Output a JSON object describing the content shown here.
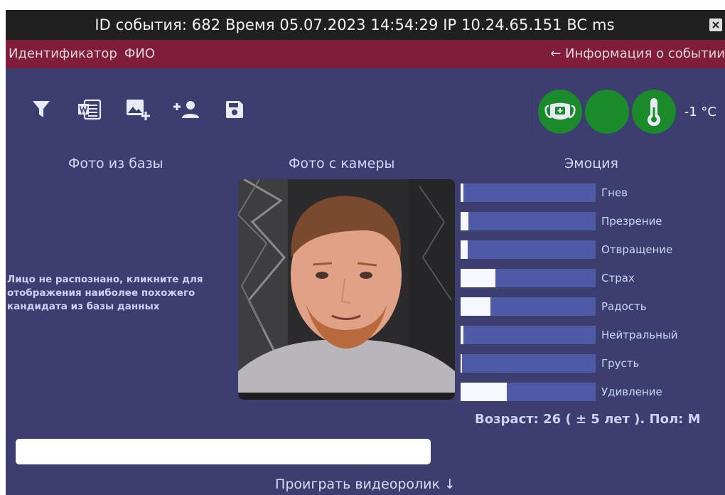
{
  "titlebar": {
    "title": "ID события: 682  Время 05.07.2023 14:54:29 IP 10.24.65.151 BC  ms"
  },
  "subbar": {
    "tab_identifier": "Идентификатор",
    "tab_fio": "ФИО",
    "info_link": "← Информация о событии"
  },
  "toolbar": {
    "icons": [
      "filter-icon",
      "word-document-icon",
      "add-image-icon",
      "add-person-icon",
      "save-icon"
    ]
  },
  "indicators": {
    "mask_status_color": "#1b8a2b",
    "temperature": "-1 °C"
  },
  "columns": {
    "db_photo": "Фото из базы",
    "camera_photo": "Фото с камеры",
    "emotion": "Эмоция"
  },
  "notice": "Лицо не распознано, кликните для отображения наиболее похожего кандидата из базы данных",
  "emotions": [
    {
      "label": "Гнев",
      "value": 0.02
    },
    {
      "label": "Презрение",
      "value": 0.06
    },
    {
      "label": "Отвращение",
      "value": 0.05
    },
    {
      "label": "Страх",
      "value": 0.26
    },
    {
      "label": "Радость",
      "value": 0.22
    },
    {
      "label": "Нейтральный",
      "value": 0.02
    },
    {
      "label": "Грусть",
      "value": 0.005
    },
    {
      "label": "Удивление",
      "value": 0.34
    }
  ],
  "age_text": "Возраст: 26 ( ± 5 лет ). Пол: М",
  "play_text": "Проиграть видеоролик ↓"
}
